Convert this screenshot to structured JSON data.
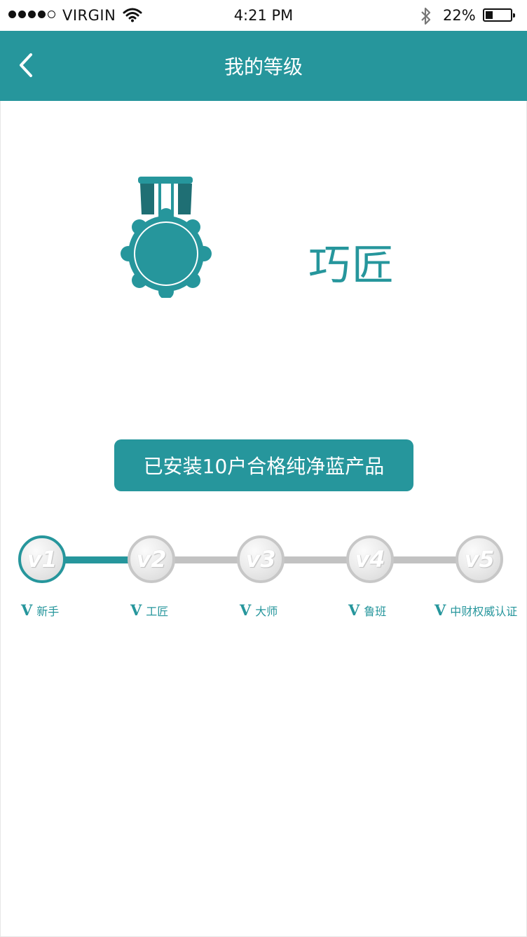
{
  "status_bar": {
    "carrier": "VIRGIN",
    "time": "4:21 PM",
    "battery_percent": "22%",
    "signal_bars_filled": 4,
    "battery_level": 0.22
  },
  "nav": {
    "title": "我的等级",
    "back_icon": "chevron-left-icon"
  },
  "current_level": {
    "name": "巧匠",
    "badge_icon": "medal-icon"
  },
  "achievement": "已安装10户合格纯净蓝产品",
  "levels": [
    {
      "code": "v1",
      "prefix": "V",
      "name": "新手",
      "active": true
    },
    {
      "code": "v2",
      "prefix": "V",
      "name": "工匠",
      "active": false
    },
    {
      "code": "v3",
      "prefix": "V",
      "name": "大师",
      "active": false
    },
    {
      "code": "v4",
      "prefix": "V",
      "name": "鲁班",
      "active": false
    },
    {
      "code": "v5",
      "prefix": "V",
      "name": "中财权威认证",
      "active": false
    }
  ],
  "colors": {
    "accent": "#26969c",
    "inactive": "#c2c2c2"
  }
}
